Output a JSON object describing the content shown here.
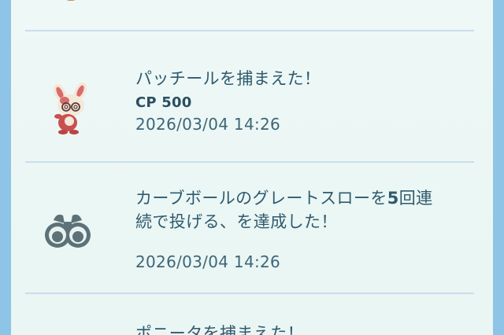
{
  "journal": {
    "entries": [
      {
        "icon": "spinda-pokemon-icon",
        "title": "パッチールを捕まえた！",
        "cp_label": "CP 500",
        "timestamp": "2026/03/04 14:26"
      },
      {
        "icon": "binoculars-icon",
        "title_part1": "カーブボールのグレートスローを",
        "title_count": "5",
        "title_part2": "回連",
        "title_line2": "続で投げる、を達成した！",
        "timestamp": "2026/03/04 14:26"
      },
      {
        "title": "ポニータを捕まえた！"
      }
    ]
  },
  "colors": {
    "panel_bg": "#eef8f6",
    "side_bg": "#8ec4e6",
    "text": "#2f5a6e",
    "divider": "#c9ddec"
  }
}
